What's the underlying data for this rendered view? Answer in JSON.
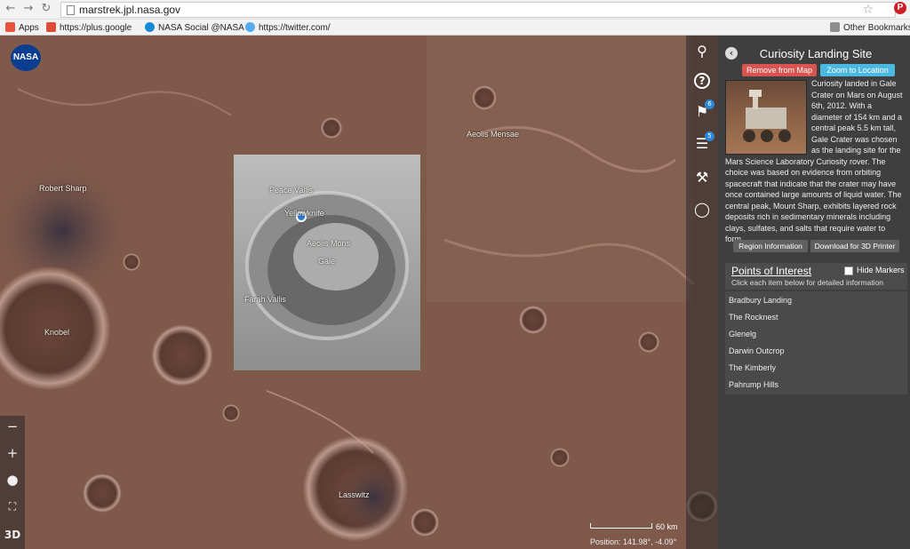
{
  "browser": {
    "url": "marstrek.jpl.nasa.gov",
    "back_icon": "back-arrow-icon",
    "forward_icon": "forward-arrow-icon",
    "reload_icon": "reload-icon",
    "bookmarks": [
      {
        "label": "Apps",
        "color": "#e8553f"
      },
      {
        "label": "https://plus.google",
        "color": "#dd4b39"
      },
      {
        "label": "NASA Social @NASA",
        "color": "#1a8ad8"
      },
      {
        "label": "https://twitter.com/",
        "color": "#55acee"
      }
    ],
    "other_bookmarks": "Other Bookmarks"
  },
  "map": {
    "logo": "NASA",
    "labels": {
      "aeolis_mensae": "Aeolis Mensae",
      "robert_sharp": "Robert Sharp",
      "peace_vallis": "Peace Vallis",
      "yellowknife": "Yellowknife",
      "aeolis_mons": "Aeolis Mons",
      "gale": "Gale",
      "farah_vallis": "Farah Vallis",
      "knobel": "Knobel",
      "lasswitz": "Lasswitz"
    },
    "tools": {
      "bookmark_badge": "6",
      "layers_badge": "5"
    },
    "zoom_out": "−",
    "zoom_in": "+",
    "mode_3d": "3D",
    "scale": "60 km",
    "position": "Position:  141.98°, -4.09°"
  },
  "panel": {
    "title": "Curiosity Landing Site",
    "remove_button": "Remove from Map",
    "zoom_button": "Zoom to Location",
    "description": "Curiosity landed in Gale Crater on Mars on August 6th, 2012. With a diameter of 154 km and a central peak 5.5 km tall, Gale Crater was chosen as the landing site for the Mars Science Laboratory Curiosity rover. The choice was based on evidence from orbiting spacecraft that indicate that the crater may have once contained large amounts of liquid water. The central peak, Mount Sharp, exhibits layered rock deposits rich in sedimentary minerals including clays, sulfates, and salts that require water to form.",
    "region_button": "Region Information",
    "download_button": "Download for 3D Printer",
    "poi": {
      "title": "Points of Interest",
      "hide_markers": "Hide Markers",
      "subtitle": "Click each item below for detailed information",
      "items": [
        "Bradbury Landing",
        "The Rocknest",
        "Glenelg",
        "Darwin Outcrop",
        "The Kimberly",
        "Pahrump Hills"
      ]
    }
  }
}
